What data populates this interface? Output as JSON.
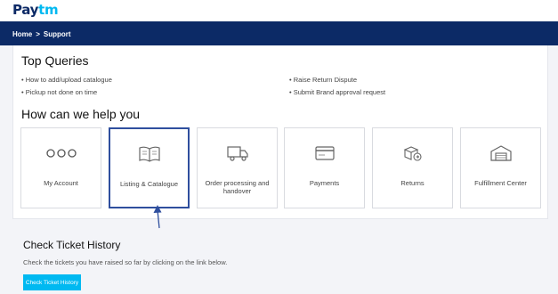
{
  "brand": {
    "pay": "Pay",
    "tm": "tm"
  },
  "breadcrumb": {
    "home": "Home",
    "separator": ">",
    "current": "Support"
  },
  "top_queries": {
    "title": "Top Queries",
    "items": [
      "• How to add/upload catalogue",
      "• Pickup not done on time",
      "• Raise Return Dispute",
      "• Submit Brand approval request"
    ]
  },
  "help": {
    "title": "How can we help you",
    "cards": [
      {
        "label": "My Account",
        "icon": "more-dots-icon"
      },
      {
        "label": "Listing & Catalogue",
        "icon": "book-icon"
      },
      {
        "label": "Order processing and handover",
        "icon": "truck-icon"
      },
      {
        "label": "Payments",
        "icon": "credit-card-icon"
      },
      {
        "label": "Returns",
        "icon": "return-box-icon"
      },
      {
        "label": "Fulfillment Center",
        "icon": "warehouse-icon"
      }
    ]
  },
  "ticket": {
    "title": "Check Ticket History",
    "description": "Check the tickets you have raised so far by clicking on the link below.",
    "button_label": "Check Ticket History"
  },
  "colors": {
    "navy": "#0c2a66",
    "accent": "#00b9f1",
    "selected_border": "#2f4f9e"
  }
}
